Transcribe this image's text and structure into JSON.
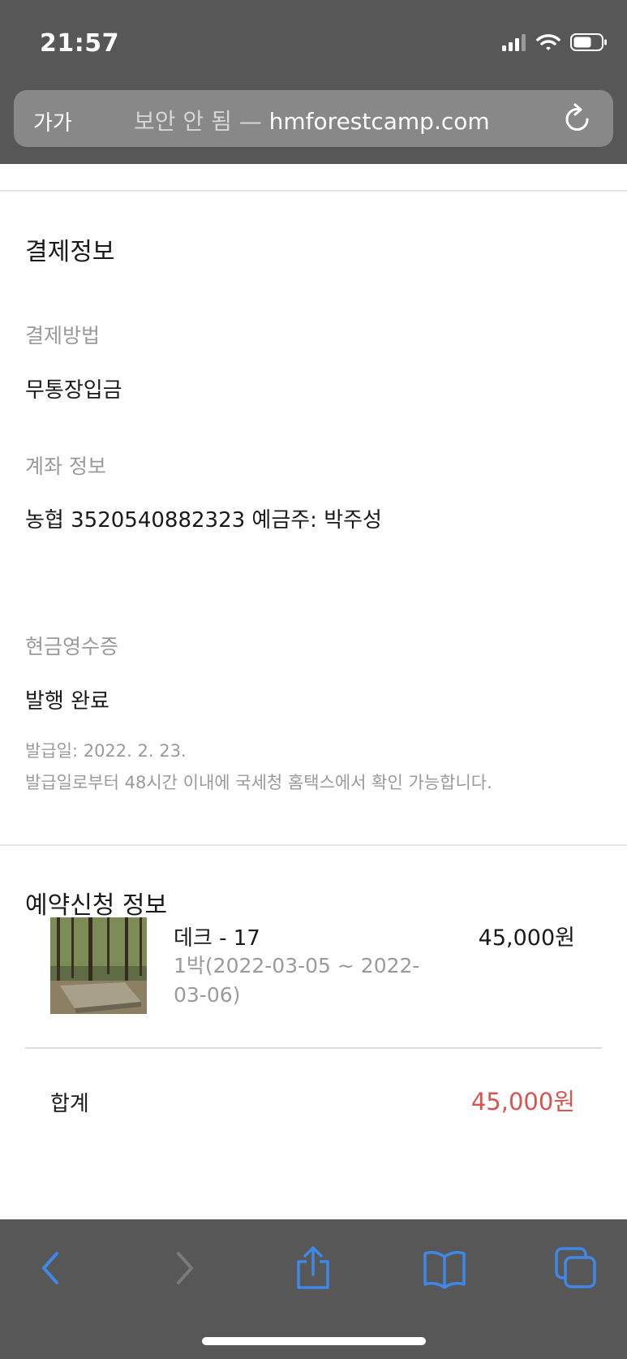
{
  "status_bar": {
    "time": "21:57"
  },
  "browser": {
    "text_size_button": "가가",
    "url_prefix": "보안 안 됨 —",
    "url_domain": "hmforestcamp.com"
  },
  "payment": {
    "title": "결제정보",
    "method_label": "결제방법",
    "method_value": "무통장입금",
    "account_label": "계좌 정보",
    "account_value": "농협 3520540882323 예금주: 박주성",
    "receipt_label": "현금영수증",
    "receipt_value": "발행 완료",
    "issue_date": "발급일: 2022. 2. 23.",
    "issue_note": "발급일로부터 48시간 이내에 국세청 홈택스에서 확인 가능합니다."
  },
  "reservation": {
    "title": "예약신청 정보",
    "item": {
      "name": "데크 - 17",
      "dates": "1박(2022-03-05 ~ 2022-03-06)",
      "price": "45,000원"
    },
    "total_label": "합계",
    "total_value": "45,000원"
  },
  "colors": {
    "chrome": "#575757",
    "accent_blue": "#3f88e8",
    "total_red": "#d9534f"
  },
  "icons": {
    "back": "chevron-left-icon",
    "forward": "chevron-right-icon",
    "share": "share-icon",
    "bookmarks": "book-icon",
    "tabs": "tabs-icon",
    "reload": "reload-icon"
  }
}
